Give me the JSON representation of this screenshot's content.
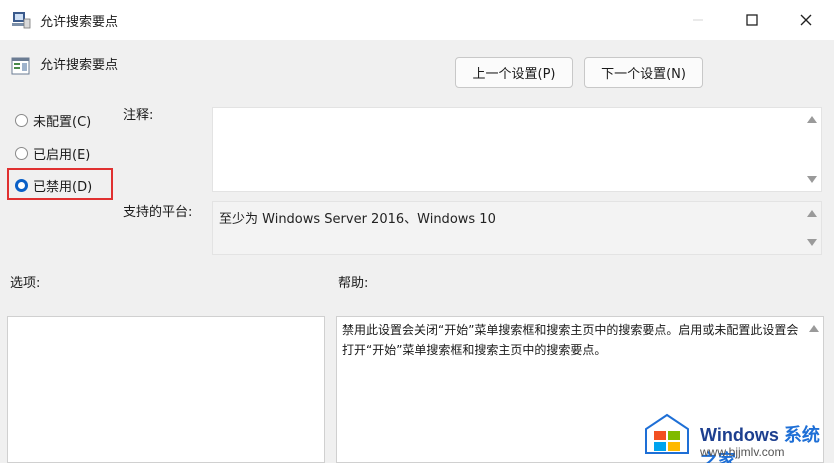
{
  "window": {
    "title": "允许搜索要点",
    "minimize_icon": "minimize-icon",
    "maximize_icon": "maximize-icon",
    "close_icon": "close-icon"
  },
  "header": {
    "setting_name": "允许搜索要点",
    "prev_button": "上一个设置(P)",
    "next_button": "下一个设置(N)"
  },
  "options": {
    "not_configured": "未配置(C)",
    "enabled": "已启用(E)",
    "disabled": "已禁用(D)",
    "selected": "disabled",
    "highlight_color": "#e03030"
  },
  "fields": {
    "comment_label": "注释:",
    "comment_value": "",
    "supported_label": "支持的平台:",
    "supported_value": "至少为 Windows Server 2016、Windows 10",
    "options_label": "选项:",
    "help_label": "帮助:",
    "help_text": "禁用此设置会关闭“开始”菜单搜索框和搜索主页中的搜索要点。启用或未配置此设置会打开“开始”菜单搜索框和搜索主页中的搜索要点。"
  },
  "watermark": {
    "brand": "Windows",
    "brand_cn": "系统之家",
    "url": "www.bjjmlv.com"
  },
  "colors": {
    "accent": "#0a5fc7",
    "background": "#f0f0f0"
  }
}
